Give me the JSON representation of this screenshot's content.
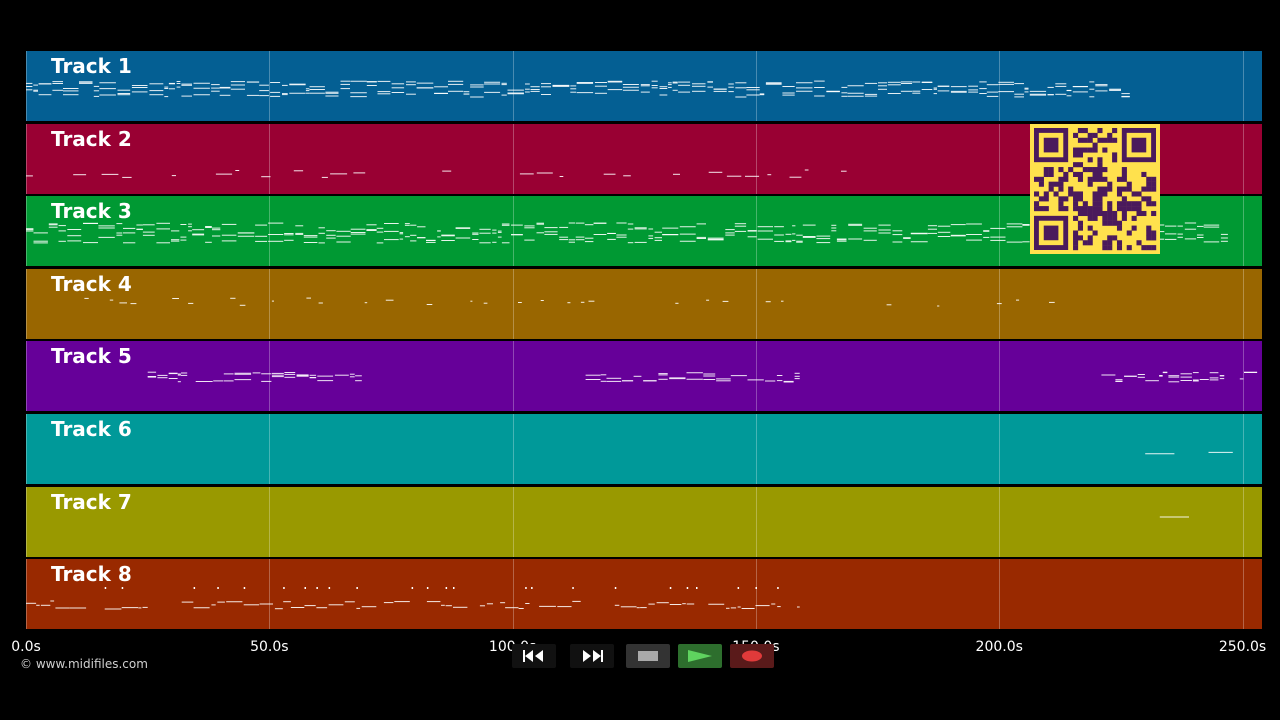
{
  "tracks": [
    {
      "label": "Track 1",
      "color": "#045f93"
    },
    {
      "label": "Track 2",
      "color": "#990033"
    },
    {
      "label": "Track 3",
      "color": "#009933"
    },
    {
      "label": "Track 4",
      "color": "#996600"
    },
    {
      "label": "Track 5",
      "color": "#660099"
    },
    {
      "label": "Track 6",
      "color": "#009999"
    },
    {
      "label": "Track 7",
      "color": "#999900"
    },
    {
      "label": "Track 8",
      "color": "#992900"
    }
  ],
  "timeline": {
    "ticks": [
      "0.0s",
      "50.0s",
      "100.0s",
      "150.0s",
      "200.0s",
      "250.0s"
    ],
    "tick_values": [
      0,
      50,
      100,
      150,
      200,
      250
    ],
    "range": [
      0,
      254
    ]
  },
  "copyright": "© www.midifiles.com",
  "transport": {
    "rewind": "rewind-icon",
    "fast_forward": "fast-forward-icon",
    "stop": "stop-icon",
    "play": "play-icon",
    "record": "record-icon"
  },
  "qr_code": "qr-code-icon"
}
